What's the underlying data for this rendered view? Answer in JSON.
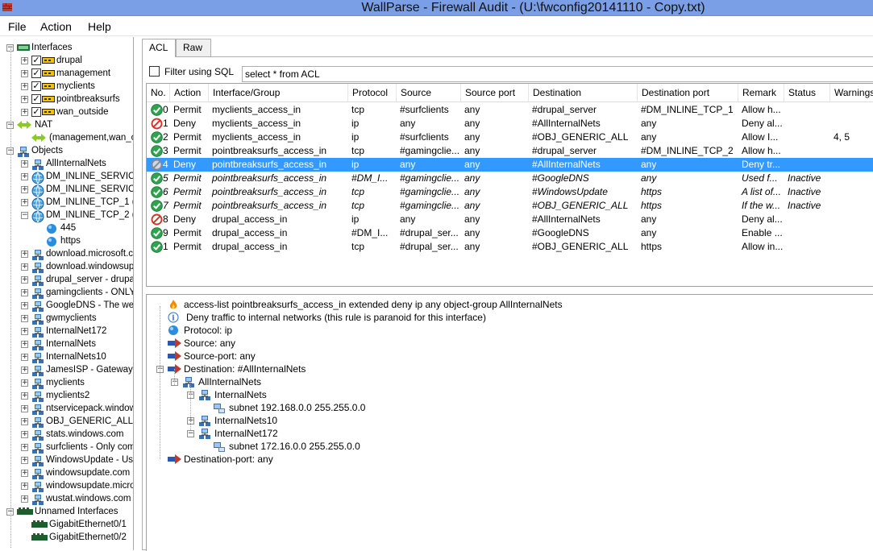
{
  "window": {
    "title": "WallParse - Firewall Audit - (U:\\fwconfig20141110 - Copy.txt)"
  },
  "menu": {
    "file": "File",
    "action": "Action",
    "help": "Help"
  },
  "tree": {
    "interfaces": "Interfaces",
    "ifaces": [
      "drupal",
      "management",
      "myclients",
      "pointbreaksurfs",
      "wan_outside"
    ],
    "nat": "NAT",
    "nat_child": "(management,wan_out",
    "objects": "Objects",
    "objs": [
      "AllInternalNets",
      "DM_INLINE_SERVIC",
      "DM_INLINE_SERVIC",
      "DM_INLINE_TCP_1 (",
      "DM_INLINE_TCP_2 ("
    ],
    "tcp2_children": [
      "445",
      "https"
    ],
    "objs2": [
      "download.microsoft.co",
      "download.windowsup",
      "drupal_server - drupal",
      "gamingclients - ONLY",
      "GoogleDNS - The we",
      "gwmyclients",
      "InternalNet172",
      "InternalNets",
      "InternalNets10",
      "JamesISP - Gateway t",
      "myclients",
      "myclients2",
      "ntservicepack.window",
      "OBJ_GENERIC_ALL",
      "stats.windows.com",
      "surfclients - Only comp",
      "WindowsUpdate - Use",
      "windowsupdate.com",
      "windowsupdate.micro",
      "wustat.windows.com"
    ],
    "unnamed": "Unnamed Interfaces",
    "unnamed_children": [
      "GigabitEthernet0/1",
      "GigabitEthernet0/2"
    ]
  },
  "tabs": {
    "acl": "ACL",
    "raw": "Raw"
  },
  "filter": {
    "label": "Filter using SQL",
    "query": "select * from ACL"
  },
  "grid": {
    "columns": [
      "No.",
      "Action",
      "Interface/Group",
      "Protocol",
      "Source",
      "Source port",
      "Destination",
      "Destination port",
      "Remark",
      "Status",
      "Warnings"
    ],
    "rows": [
      {
        "icon": "permit",
        "no": "0",
        "action": "Permit",
        "iface": "myclients_access_in",
        "proto": "tcp",
        "src": "#surfclients",
        "sport": "any",
        "dst": "#drupal_server",
        "dport": "#DM_INLINE_TCP_1",
        "remark": "Allow h...",
        "status": "",
        "warn": ""
      },
      {
        "icon": "deny",
        "no": "1",
        "action": "Deny",
        "iface": "myclients_access_in",
        "proto": "ip",
        "src": "any",
        "sport": "any",
        "dst": "#AllInternalNets",
        "dport": "any",
        "remark": "Deny al...",
        "status": "",
        "warn": ""
      },
      {
        "icon": "permit",
        "no": "2",
        "action": "Permit",
        "iface": "myclients_access_in",
        "proto": "ip",
        "src": "#surfclients",
        "sport": "any",
        "dst": "#OBJ_GENERIC_ALL",
        "dport": "any",
        "remark": "Allow I...",
        "status": "",
        "warn": "4, 5"
      },
      {
        "icon": "permit",
        "no": "3",
        "action": "Permit",
        "iface": "pointbreaksurfs_access_in",
        "proto": "tcp",
        "src": "#gamingclie...",
        "sport": "any",
        "dst": "#drupal_server",
        "dport": "#DM_INLINE_TCP_2",
        "remark": "Allow h...",
        "status": "",
        "warn": ""
      },
      {
        "icon": "deny",
        "no": "4",
        "action": "Deny",
        "iface": "pointbreaksurfs_access_in",
        "proto": "ip",
        "src": "any",
        "sport": "any",
        "dst": "#AllInternalNets",
        "dport": "any",
        "remark": "Deny tr...",
        "status": "",
        "warn": "",
        "selected": true
      },
      {
        "icon": "permit",
        "no": "5",
        "action": "Permit",
        "iface": "pointbreaksurfs_access_in",
        "proto": "#DM_I...",
        "src": "#gamingclie...",
        "sport": "any",
        "dst": "#GoogleDNS",
        "dport": "any",
        "remark": "Used f...",
        "status": "Inactive",
        "warn": "",
        "inactive": true
      },
      {
        "icon": "permit",
        "no": "6",
        "action": "Permit",
        "iface": "pointbreaksurfs_access_in",
        "proto": "tcp",
        "src": "#gamingclie...",
        "sport": "any",
        "dst": "#WindowsUpdate",
        "dport": "https",
        "remark": "A list of...",
        "status": "Inactive",
        "warn": "",
        "inactive": true
      },
      {
        "icon": "permit",
        "no": "7",
        "action": "Permit",
        "iface": "pointbreaksurfs_access_in",
        "proto": "tcp",
        "src": "#gamingclie...",
        "sport": "any",
        "dst": "#OBJ_GENERIC_ALL",
        "dport": "https",
        "remark": "If the w...",
        "status": "Inactive",
        "warn": "",
        "inactive": true
      },
      {
        "icon": "deny",
        "no": "8",
        "action": "Deny",
        "iface": "drupal_access_in",
        "proto": "ip",
        "src": "any",
        "sport": "any",
        "dst": "#AllInternalNets",
        "dport": "any",
        "remark": "Deny al...",
        "status": "",
        "warn": ""
      },
      {
        "icon": "permit",
        "no": "9",
        "action": "Permit",
        "iface": "drupal_access_in",
        "proto": "#DM_I...",
        "src": "#drupal_ser...",
        "sport": "any",
        "dst": "#GoogleDNS",
        "dport": "any",
        "remark": "Enable ...",
        "status": "",
        "warn": ""
      },
      {
        "icon": "permit",
        "no": "1",
        "action": "Permit",
        "iface": "drupal_access_in",
        "proto": "tcp",
        "src": "#drupal_ser...",
        "sport": "any",
        "dst": "#OBJ_GENERIC_ALL",
        "dport": "https",
        "remark": "Allow in...",
        "status": "",
        "warn": ""
      }
    ]
  },
  "detail": {
    "acl_line": "access-list pointbreaksurfs_access_in extended deny ip any object-group AllInternalNets",
    "remark": "Deny traffic to internal networks (this rule is paranoid for this interface)",
    "protocol": "Protocol: ip",
    "source": "Source: any",
    "source_port": "Source-port: any",
    "destination": "Destination: #AllInternalNets",
    "all_internal": "AllInternalNets",
    "internal_nets": "InternalNets",
    "subnet1": "subnet 192.168.0.0 255.255.0.0",
    "internal_nets10": "InternalNets10",
    "internal_net172": "InternalNet172",
    "subnet2": "subnet 172.16.0.0 255.255.0.0",
    "dest_port": "Destination-port: any"
  },
  "colors": {
    "titlebar": "#7a9fe6",
    "selection": "#3399ff",
    "permit": "#2ea44f",
    "deny": "#d93025"
  }
}
